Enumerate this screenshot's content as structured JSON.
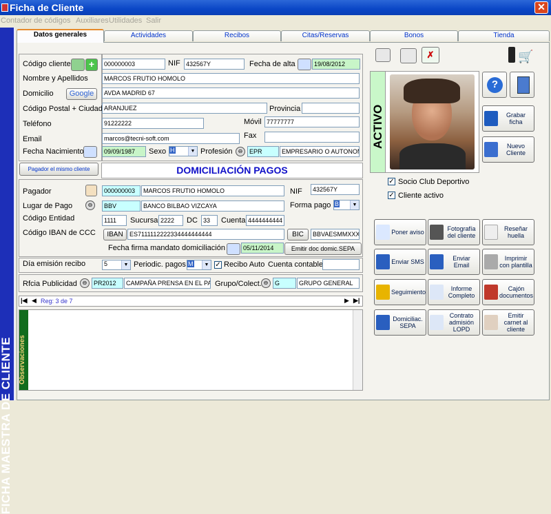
{
  "window": {
    "title": "Ficha de Cliente",
    "close": "✕"
  },
  "menu": [
    "Contador de códigos",
    "Auxiliares",
    "Utilidades",
    "Salir"
  ],
  "sidebar": {
    "text": "FICHA MAESTRA DE CLIENTE"
  },
  "tabs": [
    "Datos generales",
    "Actividades",
    "Recibos",
    "Citas/Reservas",
    "Bonos",
    "Tienda"
  ],
  "client": {
    "codigo_label": "Código cliente",
    "codigo": "000000003",
    "nif_label": "NIF",
    "nif": "432567Y",
    "alta_label": "Fecha de alta",
    "alta": "19/08/2012",
    "nombre_label": "Nombre y Apellidos",
    "nombre": "MARCOS FRUTIO HOMOLO",
    "domicilio_label": "Domicilio",
    "google": "Google",
    "domicilio": "AVDA MADRID 67",
    "cp_label": "Código Postal + Ciudad",
    "ciudad": "ARANJUEZ",
    "provincia_label": "Provincia",
    "provincia": "",
    "telefono_label": "Teléfono",
    "telefono": "91222222",
    "movil_label": "Móvil",
    "movil": "77777777",
    "email_label": "Email",
    "email": "marcos@tecni-soft.com",
    "fax_label": "Fax",
    "fax": "",
    "nac_label": "Fecha Nacimiento",
    "nac": "09/09/1987",
    "sexo_label": "Sexo",
    "sexo": "H",
    "profesion_label": "Profesión",
    "profesion_code": "EPR",
    "profesion": "EMPRESARIO O AUTONOM"
  },
  "domiciliacion": {
    "pagador_btn": "Pagador el mismo cliente",
    "header": "DOMICILIACIÓN PAGOS",
    "pagador_label": "Pagador",
    "pagador_code": "000000003",
    "pagador_name": "MARCOS FRUTIO HOMOLO",
    "nif_label": "NIF",
    "nif": "432567Y",
    "lugar_label": "Lugar de Pago",
    "banco_code": "BBV",
    "banco": "BANCO BILBAO VIZCAYA",
    "forma_label": "Forma pago",
    "forma": "B",
    "entidad_label": "Código Entidad",
    "entidad": "1111",
    "sucursal_label": "Sucursal",
    "sucursal": "2222",
    "dc_label": "DC",
    "dc": "33",
    "cuenta_label": "Cuenta",
    "cuenta": "4444444444",
    "iban_label": "Código IBAN de CCC",
    "iban_btn": "IBAN",
    "iban": "ES7111112222334444444444",
    "bic_btn": "BIC",
    "bic": "BBVAESMMXXX",
    "mandato_label": "Fecha firma mandato domiciliación",
    "mandato": "05/11/2014",
    "sepa_btn": "Emitir doc domic.SEPA"
  },
  "recibos": {
    "dia_label": "Día emisión recibo",
    "dia": "5",
    "periodic_label": "Periodic. pagos",
    "periodic": "M",
    "recibo_auto": "Recibo Auto",
    "contable_label": "Cuenta contable",
    "contable": ""
  },
  "publicidad": {
    "label": "Rfcia Publicidad",
    "code": "PR2012",
    "text": "CAMPAÑA PRENSA EN EL PAI",
    "grupo_label": "Grupo/Colect.",
    "grupo_code": "G",
    "grupo": "GRUPO GENERAL"
  },
  "nav": {
    "record": "Reg: 3 de 7"
  },
  "obs": {
    "label": "Observaciones"
  },
  "right": {
    "status": "ACTIVO",
    "grabar": "Grabar ficha",
    "nuevo": "Nuevo Cliente",
    "socio": "Socio Club Deportivo",
    "activo": "Cliente activo",
    "buttons": [
      [
        "Poner aviso",
        "Fotografía del cliente",
        "Reseñar huella"
      ],
      [
        "Enviar SMS",
        "Enviar Email",
        "Imprimir con plantilla"
      ],
      [
        "Seguimiento",
        "Informe Completo",
        "Cajón documentos"
      ],
      [
        "Domiciliac. SEPA",
        "Contrato admisión LOPD",
        "Emitir carnet al cliente"
      ]
    ]
  },
  "colors": {
    "sidebar": "#1d2fb8",
    "title": "#0a46c6",
    "status": "#c9f7c9",
    "accent": "#1010c8"
  }
}
